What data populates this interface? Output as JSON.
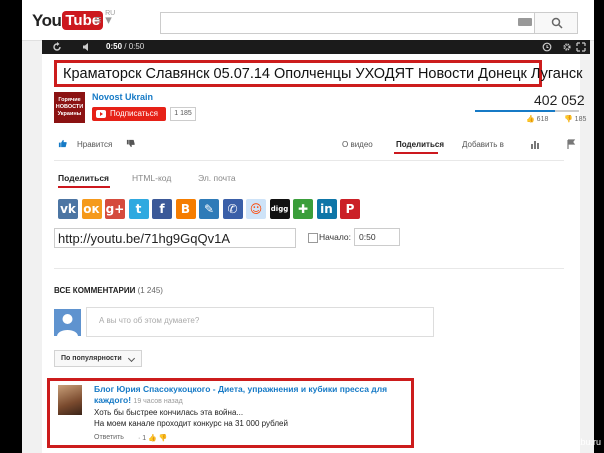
{
  "header": {
    "logo_you": "You",
    "logo_tube": "Tube",
    "logo_region": "RU",
    "guide_icon": "≡ ▾"
  },
  "player": {
    "current_time": "0:50",
    "separator": " / ",
    "duration": "0:50"
  },
  "video": {
    "title": "Краматорск Славянск 05.07.14 Ополченцы УХОДЯТ Новости Донецк Луганск",
    "channel_name": "Novost Ukrain",
    "channel_thumb_text": "Горячие НОВОСТИ Украины",
    "subscribe_label": "Подписаться",
    "subscriber_count": "1 185",
    "views": "402 052",
    "likes": "618",
    "dislikes": "185",
    "like_ratio": 0.77
  },
  "actions": {
    "like_label": "Нравится",
    "about_tab": "О видео",
    "share_tab": "Поделиться",
    "add_tab": "Добавить в"
  },
  "share": {
    "tabs": [
      "Поделиться",
      "HTML-код",
      "Эл. почта"
    ],
    "url": "http://youtu.be/71hg9GqQv1A",
    "start_label": "Начало:",
    "start_value": "0:50",
    "networks": [
      {
        "name": "vk",
        "glyph": "vk",
        "color": "#4c75a3"
      },
      {
        "name": "odnoklassniki",
        "glyph": "ок",
        "color": "#f59a1b"
      },
      {
        "name": "google-plus",
        "glyph": "g+",
        "color": "#d54b3d"
      },
      {
        "name": "twitter",
        "glyph": "t",
        "color": "#2fa9e0"
      },
      {
        "name": "facebook",
        "glyph": "f",
        "color": "#3b5998"
      },
      {
        "name": "blogger",
        "glyph": "B",
        "color": "#f57d00"
      },
      {
        "name": "livejournal",
        "glyph": "✎",
        "color": "#2e7bb8"
      },
      {
        "name": "myspace",
        "glyph": "✆",
        "color": "#3a5fa8"
      },
      {
        "name": "reddit",
        "glyph": "☺",
        "color": "#cee3f8"
      },
      {
        "name": "digg",
        "glyph": "digg",
        "color": "#111111"
      },
      {
        "name": "stumbleupon",
        "glyph": "✚",
        "color": "#3b9e3b"
      },
      {
        "name": "linkedin",
        "glyph": "in",
        "color": "#0e76a8"
      },
      {
        "name": "pinterest",
        "glyph": "P",
        "color": "#cb2027"
      }
    ]
  },
  "comments": {
    "heading": "ВСЕ КОММЕНТАРИИ",
    "count": "(1 245)",
    "input_placeholder": "А вы что об этом думаете?",
    "sort_label": "По популярности",
    "items": [
      {
        "author": "Блог Юрия Спасокукоцкого - Диета, упражнения и кубики пресса для каждого!",
        "time": "19 часов назад",
        "line1": "Хоть бы быстрее кончилась эта война...",
        "line2": "На моем канале проходит конкурс на 31 000 рублей",
        "reply": "Ответить",
        "score": "1"
      }
    ]
  },
  "watermark": "pikabu.ru",
  "colors": {
    "accent_red": "#cc181e",
    "link_blue": "#167ac6",
    "subscribe_red": "#e62117"
  }
}
